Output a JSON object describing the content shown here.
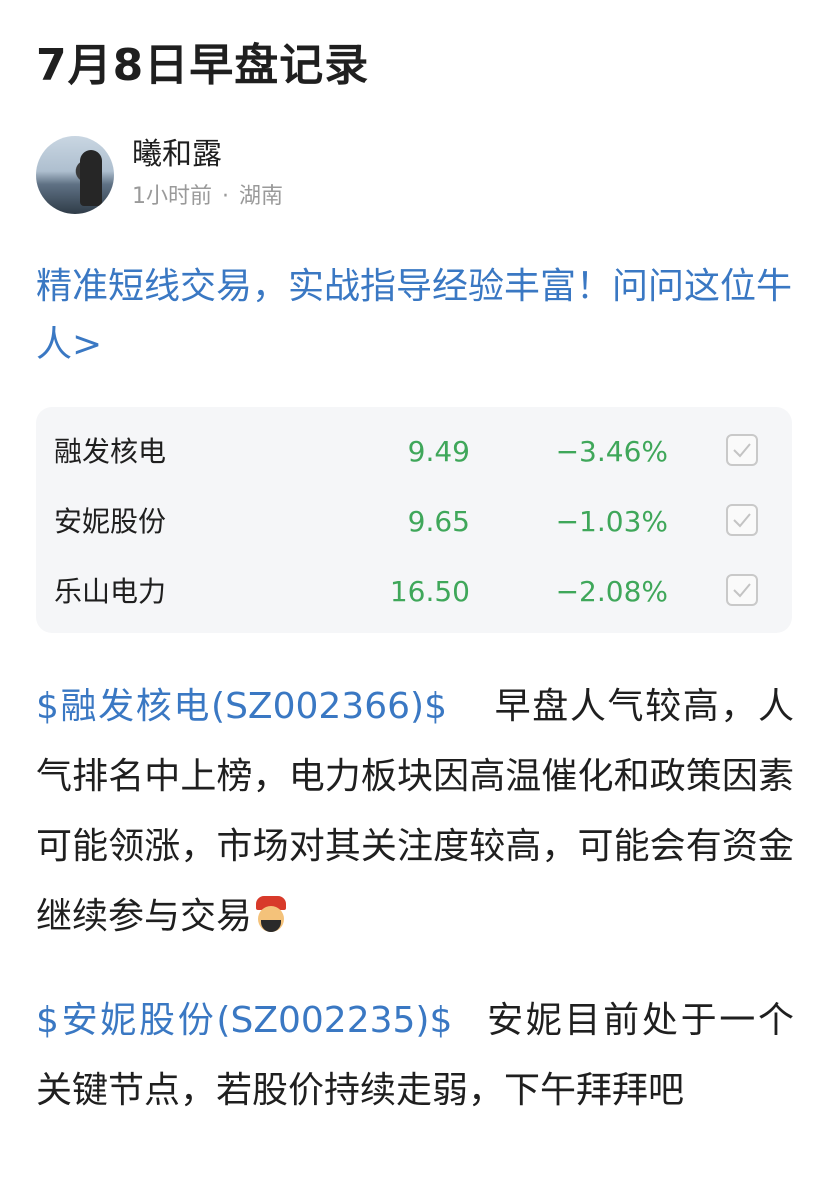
{
  "post": {
    "title": "7月8日早盘记录",
    "author": {
      "name": "曦和露",
      "time": "1小时前",
      "separator": "·",
      "location": "湖南"
    },
    "promo_link": "精准短线交易，实战指导经验丰富！问问这位牛人>"
  },
  "stocks": [
    {
      "name": "融发核电",
      "price": "9.49",
      "change": "−3.46%"
    },
    {
      "name": "安妮股份",
      "price": "9.65",
      "change": "−1.03%"
    },
    {
      "name": "乐山电力",
      "price": "16.50",
      "change": "−2.08%"
    }
  ],
  "paragraphs": [
    {
      "tag": "$融发核电(SZ002366)$",
      "text": "早盘人气较高，人气排名中上榜，电力板块因高温催化和政策因素可能领涨，市场对其关注度较高，可能会有资金继续参与交易"
    },
    {
      "tag": "$安妮股份(SZ002235)$",
      "text": "安妮目前处于一个关键节点，若股价持续走弱，下午拜拜吧"
    }
  ],
  "colors": {
    "link": "#3a78c3",
    "down": "#3fa75a",
    "text": "#1f1f1f",
    "meta": "#9a9a9a",
    "card_bg": "#f5f6f8"
  },
  "icons": {
    "avatar": "avatar-photo",
    "check": "check-icon",
    "emoji": "god-of-wealth-emoji"
  }
}
